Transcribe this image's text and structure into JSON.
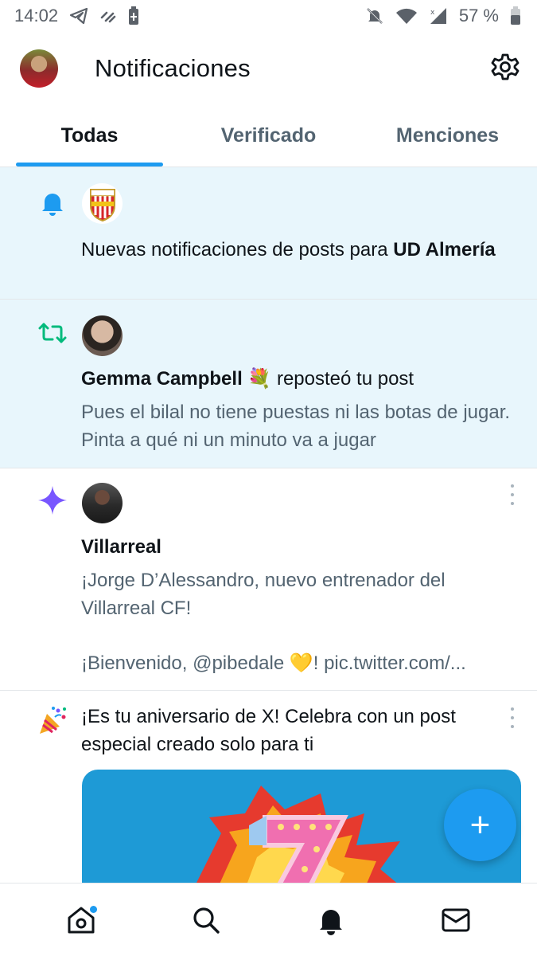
{
  "status_bar": {
    "time": "14:02",
    "battery": "57 %",
    "icons_left": [
      "telegram-icon",
      "link-icon",
      "battery-saver-icon"
    ],
    "icons_right": [
      "mute-icon",
      "wifi-icon",
      "signal-icon",
      "battery-icon"
    ]
  },
  "header": {
    "title": "Notificaciones",
    "avatar": "user-avatar",
    "settings_icon": "gear-icon"
  },
  "tabs": [
    {
      "label": "Todas",
      "active": true
    },
    {
      "label": "Verificado",
      "active": false
    },
    {
      "label": "Menciones",
      "active": false
    }
  ],
  "notifications": [
    {
      "type": "bell",
      "icon": "bell-icon",
      "text_pre": "Nuevas notificaciones de posts para ",
      "text_bold": "UD Almería",
      "unread": true
    },
    {
      "type": "repost",
      "icon": "repost-icon",
      "user": "Gemma Campbell",
      "emoji": "💐",
      "action": " reposteó tu post",
      "preview": "Pues el bilal no tiene puestas ni las botas de jugar. Pinta a qué ni un minuto va a jugar",
      "unread": true
    },
    {
      "type": "recommendation",
      "icon": "sparkle-icon",
      "user": "Villarreal",
      "preview_line1": "¡Jorge D’Alessandro, nuevo entrenador del Villarreal CF!",
      "preview_line2": "¡Bienvenido, @pibedale 💛! pic.twitter.com/...",
      "unread": false
    },
    {
      "type": "anniversary",
      "icon": "party-popper-icon",
      "text": "¡Es tu aniversario de X! Celebra con un post especial creado solo para ti",
      "unread": false
    }
  ],
  "fab_label": "+",
  "bottom_nav": [
    "home-icon",
    "search-icon",
    "notifications-icon",
    "messages-icon"
  ],
  "colors": {
    "accent": "#1d9bf0",
    "unread_bg": "#e8f6fc",
    "repost_green": "#00ba7c",
    "sparkle_purple": "#7856ff"
  }
}
